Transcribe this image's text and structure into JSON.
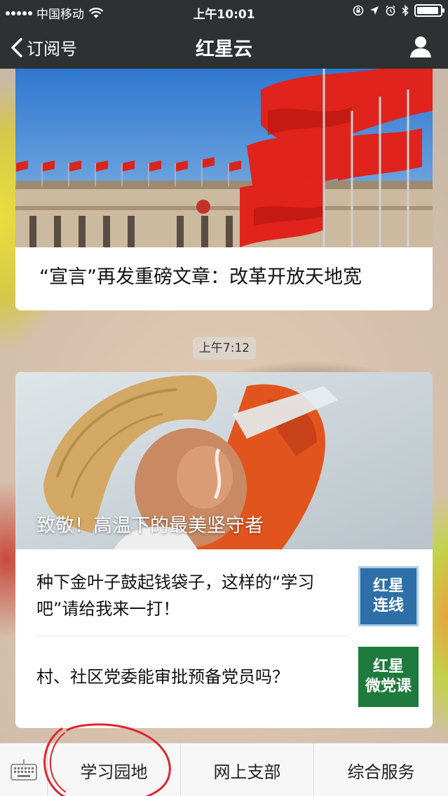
{
  "status_bar": {
    "carrier": "中国移动",
    "time": "上午10:01"
  },
  "nav": {
    "back_label": "订阅号",
    "title": "红星云"
  },
  "article1": {
    "title": "“宣言”再发重磅文章：改革开放天地宽"
  },
  "timestamp": "上午7:12",
  "article2": {
    "headline": "致敬！高温下的最美坚守者",
    "items": [
      {
        "text": "种下金叶子鼓起钱袋子，这样的“学习吧”请给我来一打！",
        "thumb_text": [
          "红星",
          "连线"
        ]
      },
      {
        "text": "村、社区党委能审批预备党员吗？",
        "thumb_text": [
          "红星",
          "微党课"
        ]
      }
    ]
  },
  "menu": {
    "items": [
      "学习园地",
      "网上支部",
      "综合服务"
    ]
  },
  "colors": {
    "bar": "#2e3132",
    "thumb1": "#2f6fa8",
    "thumb2": "#1f7a3d",
    "annotation": "#e0242f"
  }
}
